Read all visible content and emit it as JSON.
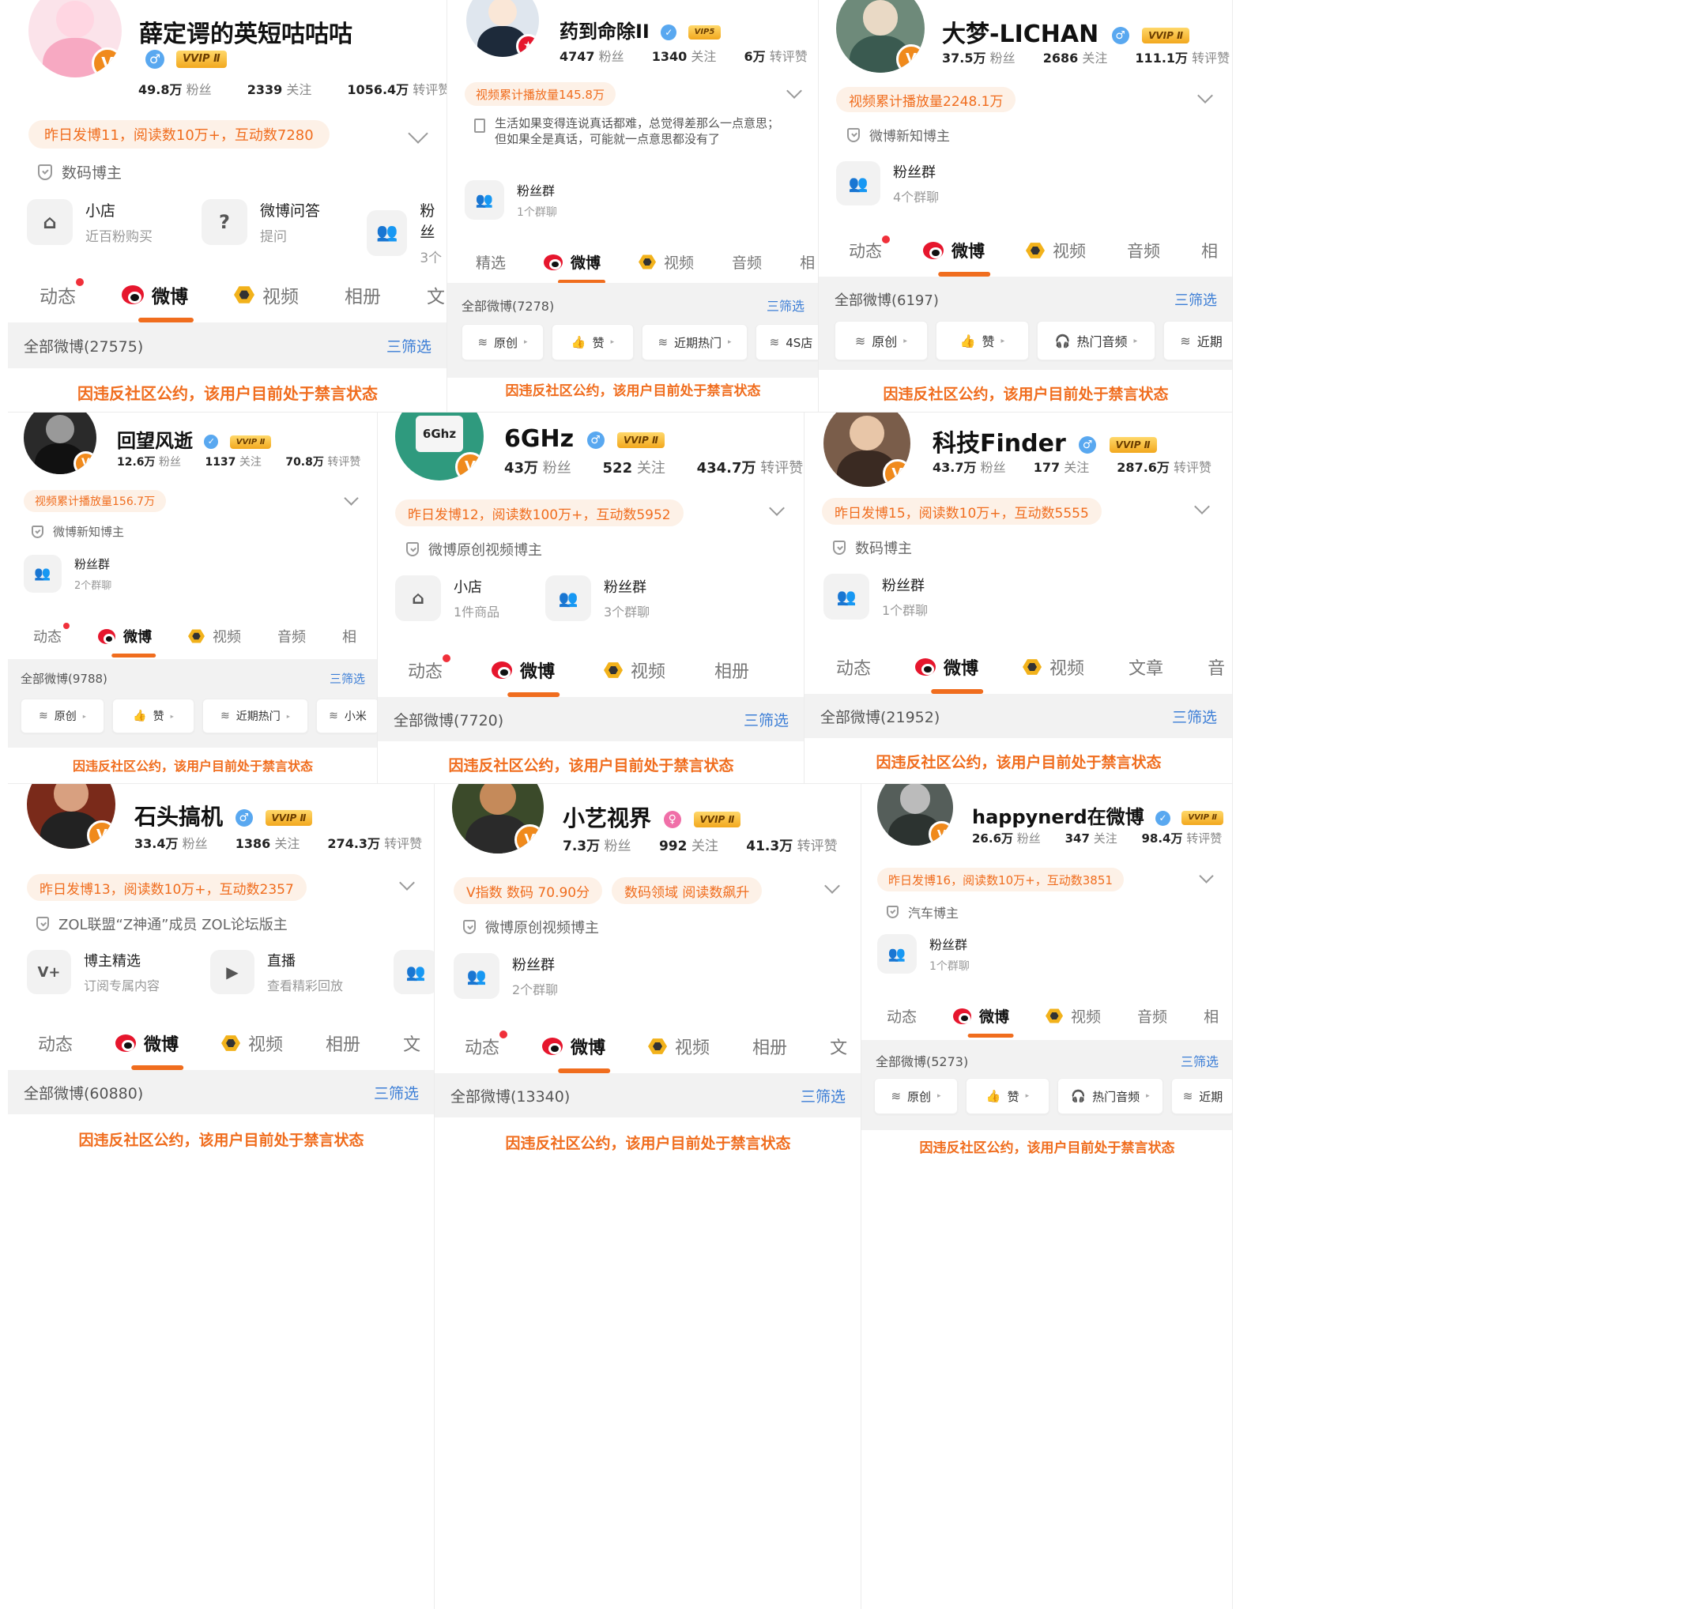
{
  "colors": {
    "accent": "#f06d1e",
    "pill_bg": "#fdf1e7",
    "link": "#3c7ed6",
    "gray_bar": "#f2f2f2",
    "vip_gold": "#f2a81e"
  },
  "panels": {
    "p1": {
      "name": "薛定谔的英短咕咕咕",
      "vip": "VVIP Ⅱ",
      "gender": "♂",
      "fans": "49.8万",
      "fans_l": "粉丝",
      "follow": "2339",
      "follow_l": "关注",
      "likes": "1056.4万",
      "likes_l": "转评赞",
      "pill": "昨日发博11，阅读数10万+，互动数7280",
      "cert": "数码博主",
      "tile1_t": "小店",
      "tile1_s": "近百粉购买",
      "tile1_icon": "shop-icon",
      "tile2_t": "微博问答",
      "tile2_s": "提问",
      "tile2_icon": "question-icon",
      "tile3_t": "粉丝",
      "tile3_s": "3个",
      "tile3_icon": "group-icon",
      "tabs": [
        "动态",
        "微博",
        "视频",
        "相册",
        "文"
      ],
      "all": "全部微博(27575)",
      "filter": "三筛选",
      "ban": "因违反社区公约，该用户目前处于禁言状态"
    },
    "p2": {
      "name": "药到命除II",
      "vip": "VIP5",
      "gender": "✓",
      "fans": "4747",
      "fans_l": "粉丝",
      "follow": "1340",
      "follow_l": "关注",
      "likes": "6万",
      "likes_l": "转评赞",
      "pill": "视频累计播放量145.8万",
      "quote": "生活如果变得连说真话都难，总觉得差那么一点意思；但如果全是真话，可能就一点意思都没有了",
      "tile1_t": "粉丝群",
      "tile1_s": "1个群聊",
      "tabs": [
        "精选",
        "微博",
        "视频",
        "音频",
        "相"
      ],
      "all": "全部微博(7278)",
      "filter": "三筛选",
      "btns": [
        "原创",
        "赞",
        "近期热门",
        "4S店"
      ],
      "ban": "因违反社区公约，该用户目前处于禁言状态"
    },
    "p3": {
      "name": "大梦-LICHAN",
      "vip": "VVIP Ⅱ",
      "gender": "♂",
      "fans": "37.5万",
      "fans_l": "粉丝",
      "follow": "2686",
      "follow_l": "关注",
      "likes": "111.1万",
      "likes_l": "转评赞",
      "pill": "视频累计播放量2248.1万",
      "cert": "微博新知博主",
      "tile1_t": "粉丝群",
      "tile1_s": "4个群聊",
      "tabs": [
        "动态",
        "微博",
        "视频",
        "音频",
        "相"
      ],
      "all": "全部微博(6197)",
      "filter": "三筛选",
      "btns": [
        "原创",
        "赞",
        "热门音频",
        "近期"
      ],
      "ban": "因违反社区公约，该用户目前处于禁言状态"
    },
    "p4": {
      "name": "回望风逝",
      "vip": "VVIP Ⅱ",
      "gender": "✓",
      "fans": "12.6万",
      "fans_l": "粉丝",
      "follow": "1137",
      "follow_l": "关注",
      "likes": "70.8万",
      "likes_l": "转评赞",
      "pill": "视频累计播放量156.7万",
      "cert": "微博新知博主",
      "tile1_t": "粉丝群",
      "tile1_s": "2个群聊",
      "tabs": [
        "动态",
        "微博",
        "视频",
        "音频",
        "相"
      ],
      "all": "全部微博(9788)",
      "filter": "三筛选",
      "btns": [
        "原创",
        "赞",
        "近期热门",
        "小米"
      ],
      "ban": "因违反社区公约，该用户目前处于禁言状态"
    },
    "p5": {
      "name": "6GHz",
      "vip": "VVIP Ⅱ",
      "gender": "♂",
      "avatar_text": "6Ghz",
      "fans": "43万",
      "fans_l": "粉丝",
      "follow": "522",
      "follow_l": "关注",
      "likes": "434.7万",
      "likes_l": "转评赞",
      "pill": "昨日发博12，阅读数100万+，互动数5952",
      "cert": "微博原创视频博主",
      "tile1_t": "小店",
      "tile1_s": "1件商品",
      "tile2_t": "粉丝群",
      "tile2_s": "3个群聊",
      "tabs": [
        "动态",
        "微博",
        "视频",
        "相册"
      ],
      "all": "全部微博(7720)",
      "filter": "三筛选",
      "ban": "因违反社区公约，该用户目前处于禁言状态"
    },
    "p6": {
      "name": "科技Finder",
      "vip": "VVIP Ⅱ",
      "gender": "♂",
      "fans": "43.7万",
      "fans_l": "粉丝",
      "follow": "177",
      "follow_l": "关注",
      "likes": "287.6万",
      "likes_l": "转评赞",
      "pill": "昨日发博15，阅读数10万+，互动数5555",
      "cert": "数码博主",
      "tile1_t": "粉丝群",
      "tile1_s": "1个群聊",
      "tabs": [
        "动态",
        "微博",
        "视频",
        "文章",
        "音"
      ],
      "all": "全部微博(21952)",
      "filter": "三筛选",
      "ban": "因违反社区公约，该用户目前处于禁言状态"
    },
    "p7": {
      "name": "石头搞机",
      "vip": "VVIP Ⅱ",
      "gender": "♂",
      "fans": "33.4万",
      "fans_l": "粉丝",
      "follow": "1386",
      "follow_l": "关注",
      "likes": "274.3万",
      "likes_l": "转评赞",
      "pill": "昨日发博13，阅读数10万+，互动数2357",
      "cert": "ZOL联盟“Z神通”成员 ZOL论坛版主",
      "tile1_t": "博主精选",
      "tile1_s": "订阅专属内容",
      "tile2_t": "直播",
      "tile2_s": "查看精彩回放",
      "tabs": [
        "动态",
        "微博",
        "视频",
        "相册",
        "文"
      ],
      "all": "全部微博(60880)",
      "filter": "三筛选",
      "ban": "因违反社区公约，该用户目前处于禁言状态"
    },
    "p8": {
      "name": "小艺视界",
      "vip": "VVIP Ⅱ",
      "gender": "♀",
      "fans": "7.3万",
      "fans_l": "粉丝",
      "follow": "992",
      "follow_l": "关注",
      "likes": "41.3万",
      "likes_l": "转评赞",
      "pill": "V指数 数码 70.90分",
      "pill2": "数码领域 阅读数飙升",
      "cert": "微博原创视频博主",
      "tile1_t": "粉丝群",
      "tile1_s": "2个群聊",
      "tabs": [
        "动态",
        "微博",
        "视频",
        "相册",
        "文"
      ],
      "all": "全部微博(13340)",
      "filter": "三筛选",
      "ban": "因违反社区公约，该用户目前处于禁言状态"
    },
    "p9": {
      "name": "happynerd在微博",
      "vip": "VVIP Ⅱ",
      "gender": "✓",
      "fans": "26.6万",
      "fans_l": "粉丝",
      "follow": "347",
      "follow_l": "关注",
      "likes": "98.4万",
      "likes_l": "转评赞",
      "pill": "昨日发博16，阅读数10万+，互动数3851",
      "cert": "汽车博主",
      "tile1_t": "粉丝群",
      "tile1_s": "1个群聊",
      "tabs": [
        "动态",
        "微博",
        "视频",
        "音频",
        "相"
      ],
      "all": "全部微博(5273)",
      "filter": "三筛选",
      "btns": [
        "原创",
        "赞",
        "热门音频",
        "近期"
      ],
      "ban": "因违反社区公约，该用户目前处于禁言状态"
    }
  }
}
